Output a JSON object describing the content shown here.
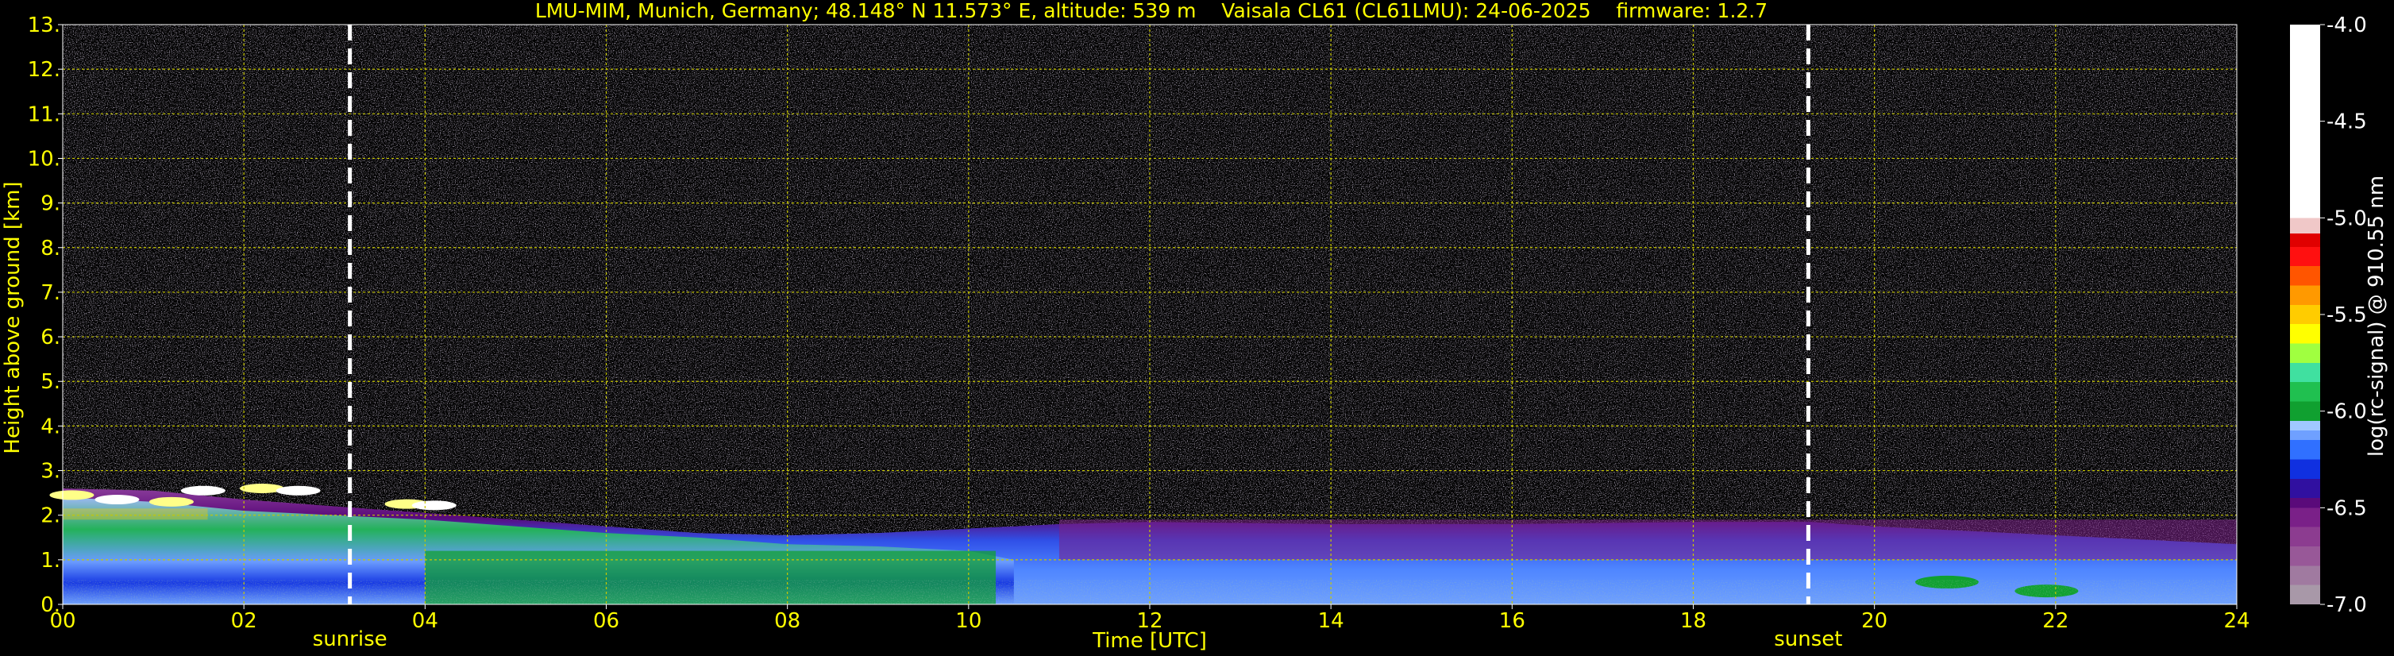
{
  "chart_data": {
    "type": "heatmap",
    "title": "LMU-MIM, Munich, Germany; 48.148° N 11.573° E, altitude: 539 m    Vaisala CL61 (CL61LMU): 24-06-2025    firmware: 1.2.7",
    "xlabel": "Time [UTC]",
    "ylabel": "Height above ground [km]",
    "xlim": [
      0,
      24
    ],
    "ylim": [
      0,
      13
    ],
    "x_ticks": [
      "00",
      "02",
      "04",
      "06",
      "08",
      "10",
      "12",
      "14",
      "16",
      "18",
      "20",
      "22",
      "24"
    ],
    "x_tick_values": [
      0,
      2,
      4,
      6,
      8,
      10,
      12,
      14,
      16,
      18,
      20,
      22,
      24
    ],
    "y_ticks": [
      "0.",
      "1.",
      "2.",
      "3.",
      "4.",
      "5.",
      "6.",
      "7.",
      "8.",
      "9.",
      "10.",
      "11.",
      "12.",
      "13."
    ],
    "y_tick_values": [
      0,
      1,
      2,
      3,
      4,
      5,
      6,
      7,
      8,
      9,
      10,
      11,
      12,
      13
    ],
    "grid": true,
    "annotations": [
      {
        "label": "sunrise",
        "x": 3.17
      },
      {
        "label": "sunset",
        "x": 19.27
      }
    ],
    "colorbar": {
      "label": "log(rc-signal) @ 910.55 nm",
      "range": [
        -7.0,
        -4.0
      ],
      "ticks": [
        "-4.0",
        "-4.5",
        "-5.0",
        "-5.5",
        "-6.0",
        "-6.5",
        "-7.0"
      ],
      "tick_values": [
        -4.0,
        -4.5,
        -5.0,
        -5.5,
        -6.0,
        -6.5,
        -7.0
      ]
    },
    "colorscale": [
      [
        -7.0,
        "#a898a8"
      ],
      [
        -6.9,
        "#a07aa0"
      ],
      [
        -6.8,
        "#985898"
      ],
      [
        -6.7,
        "#8c3c90"
      ],
      [
        -6.6,
        "#7a2088"
      ],
      [
        -6.5,
        "#5a0a7a"
      ],
      [
        -6.45,
        "#3010a0"
      ],
      [
        -6.35,
        "#1030e0"
      ],
      [
        -6.25,
        "#3070ff"
      ],
      [
        -6.15,
        "#6fa0ff"
      ],
      [
        -6.1,
        "#a0c8ff"
      ],
      [
        -6.05,
        "#10a030"
      ],
      [
        -5.95,
        "#20c050"
      ],
      [
        -5.85,
        "#40e0a0"
      ],
      [
        -5.75,
        "#a0ff40"
      ],
      [
        -5.65,
        "#ffff00"
      ],
      [
        -5.55,
        "#ffcc00"
      ],
      [
        -5.45,
        "#ff9900"
      ],
      [
        -5.35,
        "#ff5500"
      ],
      [
        -5.25,
        "#ff1010"
      ],
      [
        -5.15,
        "#e00000"
      ],
      [
        -5.08,
        "#f0c8c8"
      ],
      [
        -5.0,
        "#ffffff"
      ],
      [
        -4.0,
        "#ffffff"
      ]
    ],
    "layers": [
      {
        "name": "noise",
        "y_range": [
          2.0,
          13.0
        ],
        "dominant_value": -6.8
      },
      {
        "name": "aerosol boundary layer",
        "y_range": [
          0.0,
          2.0
        ],
        "dominant_value": -6.2
      },
      {
        "name": "lofted aerosol top",
        "x_range": [
          11.0,
          24.0
        ],
        "y_range": [
          1.0,
          1.9
        ],
        "dominant_value": -6.55
      },
      {
        "name": "early cloud",
        "x_range": [
          0.0,
          4.2
        ],
        "y_range": [
          2.2,
          2.6
        ],
        "dominant_value": -4.5
      }
    ]
  }
}
